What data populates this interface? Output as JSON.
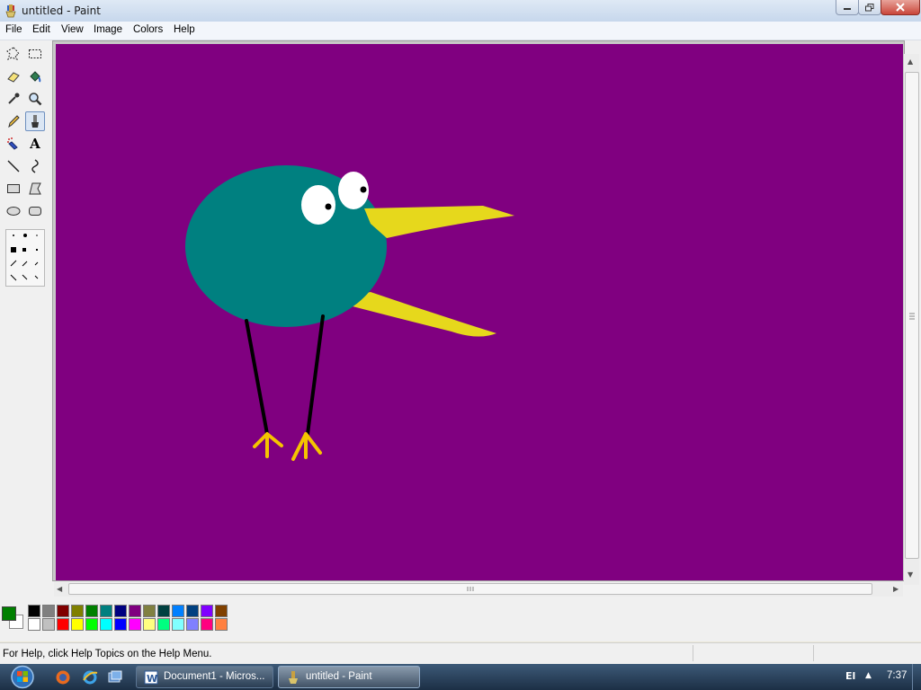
{
  "window": {
    "title": "untitled - Paint"
  },
  "menu": {
    "items": [
      "File",
      "Edit",
      "View",
      "Image",
      "Colors",
      "Help"
    ]
  },
  "toolbox": {
    "tools": [
      "free-form-select-icon",
      "select-icon",
      "eraser-icon",
      "fill-icon",
      "pick-color-icon",
      "magnifier-icon",
      "pencil-icon",
      "brush-icon",
      "airbrush-icon",
      "text-icon",
      "line-icon",
      "curve-icon",
      "rectangle-icon",
      "polygon-icon",
      "ellipse-icon",
      "rounded-rectangle-icon"
    ],
    "selected_tool": "brush-icon",
    "text_tool_glyph": "A"
  },
  "canvas": {
    "background_color": "#800080",
    "drawing": {
      "body_color": "#008080",
      "eye_color": "#ffffff",
      "pupil_color": "#000000",
      "beak_color": "#e6d81c",
      "leg_color": "#000000",
      "feet_color": "#f5c400"
    }
  },
  "colors": {
    "foreground": "#008000",
    "background": "#ffffff",
    "palette_top": [
      "#000000",
      "#808080",
      "#800000",
      "#808000",
      "#008000",
      "#008080",
      "#000080",
      "#800080",
      "#808040",
      "#004040",
      "#0080ff",
      "#004080",
      "#8000ff",
      "#804000"
    ],
    "palette_bottom": [
      "#ffffff",
      "#c0c0c0",
      "#ff0000",
      "#ffff00",
      "#00ff00",
      "#00ffff",
      "#0000ff",
      "#ff00ff",
      "#ffff80",
      "#00ff80",
      "#80ffff",
      "#8080ff",
      "#ff0080",
      "#ff8040"
    ]
  },
  "statusbar": {
    "help_text": "For Help, click Help Topics on the Help Menu."
  },
  "taskbar": {
    "tasks": [
      {
        "label": "Document1 - Micros...",
        "icon": "word-icon"
      },
      {
        "label": "untitled - Paint",
        "icon": "paint-icon"
      }
    ],
    "language": "El",
    "clock": "7:37"
  }
}
